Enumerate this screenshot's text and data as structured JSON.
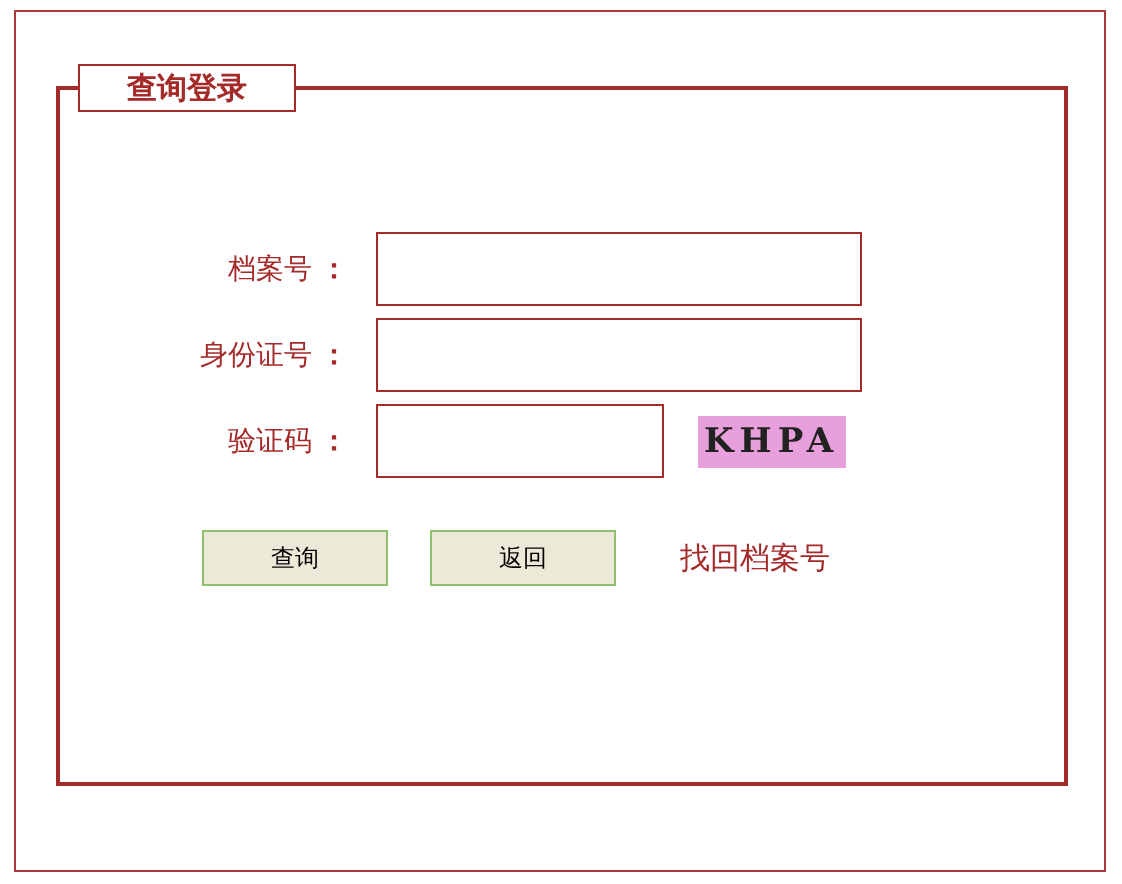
{
  "panel": {
    "title": "查询登录"
  },
  "fields": [
    {
      "kind": "text",
      "label": "档案号",
      "colon": "："
    },
    {
      "kind": "text",
      "label": "身份证号",
      "colon": "："
    },
    {
      "kind": "captcha",
      "label": "验证码",
      "colon": "：",
      "captcha": "KHPA"
    }
  ],
  "buttons": [
    "查询",
    "返回"
  ],
  "link": "找回档案号"
}
